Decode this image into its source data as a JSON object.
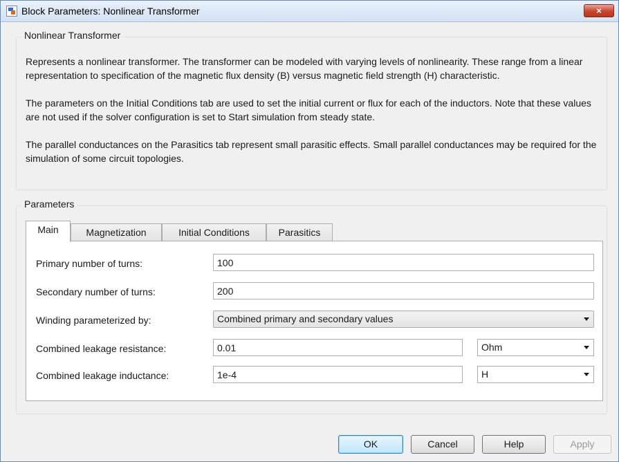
{
  "window": {
    "title": "Block Parameters: Nonlinear Transformer",
    "close_label": "×"
  },
  "description_group": {
    "label": "Nonlinear Transformer",
    "paragraphs": [
      "Represents a nonlinear transformer. The transformer can be modeled with varying levels of nonlinearity. These range from a linear representation to specification of the magnetic flux density (B) versus magnetic field strength (H) characteristic.",
      "The parameters on the Initial Conditions tab are used to set the initial current or flux for each of the inductors. Note that these values are not used if the solver configuration is set to Start simulation from steady state.",
      "The parallel conductances on the Parasitics tab represent small parasitic effects. Small parallel conductances may be required for the simulation of some circuit topologies."
    ]
  },
  "parameters_group": {
    "label": "Parameters"
  },
  "tabs": [
    {
      "label": "Main",
      "active": true
    },
    {
      "label": "Magnetization",
      "active": false
    },
    {
      "label": "Initial Conditions",
      "active": false
    },
    {
      "label": "Parasitics",
      "active": false
    }
  ],
  "fields": {
    "primary_turns": {
      "label": "Primary number of turns:",
      "value": "100"
    },
    "secondary_turns": {
      "label": "Secondary number of turns:",
      "value": "200"
    },
    "winding_param": {
      "label": "Winding parameterized by:",
      "selected": "Combined primary and secondary values"
    },
    "leakage_resistance": {
      "label": "Combined leakage resistance:",
      "value": "0.01",
      "unit": "Ohm"
    },
    "leakage_inductance": {
      "label": "Combined leakage inductance:",
      "value": "1e-4",
      "unit": "H"
    }
  },
  "buttons": {
    "ok": "OK",
    "cancel": "Cancel",
    "help": "Help",
    "apply": "Apply"
  },
  "colors": {
    "dialog_bg": "#f0f0f0",
    "close_button": "#c7462f",
    "default_button": "#bee6fd"
  },
  "icons": {
    "app": "simulink-block-icon",
    "close": "close-icon",
    "dropdown": "chevron-down-icon"
  }
}
